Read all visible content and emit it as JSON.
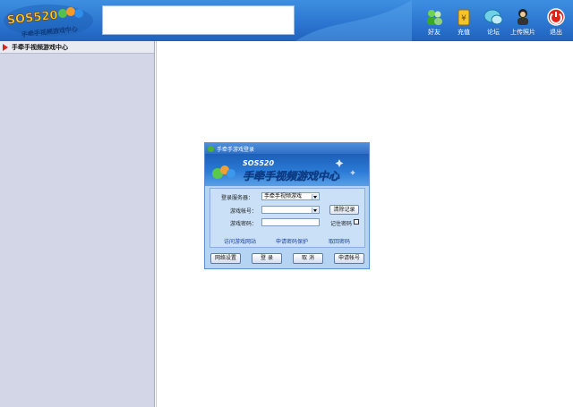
{
  "header": {
    "logo_text": "SOS520",
    "logo_subtitle": "手牵手视频游戏中心",
    "toolbar": [
      {
        "label": "好友",
        "icon": "friends-icon"
      },
      {
        "label": "充值",
        "icon": "recharge-icon"
      },
      {
        "label": "论坛",
        "icon": "forum-icon"
      },
      {
        "label": "上传照片",
        "icon": "upload-photo-icon"
      },
      {
        "label": "退出",
        "icon": "exit-icon"
      }
    ]
  },
  "sidebar": {
    "title": "手牵手视频游戏中心"
  },
  "login_dialog": {
    "title": "手牵手游戏登录",
    "banner_logo": "SOS520",
    "banner_title": "手牵手视频游戏中心",
    "server_label": "登录服务器：",
    "server_value": "手牵手视频游戏",
    "account_label": "游戏帐号：",
    "account_value": "",
    "password_label": "游戏密码：",
    "password_value": "",
    "clear_label": "清除记录",
    "remember_label": "记住密码",
    "remember_checked": false,
    "links": {
      "visit_site": "访问游戏网站",
      "apply_protection": "申请密码保护",
      "recover_password": "取回密码"
    },
    "buttons": {
      "network": "网络设置",
      "login": "登 录",
      "cancel": "取 消",
      "register": "申请帐号"
    }
  }
}
